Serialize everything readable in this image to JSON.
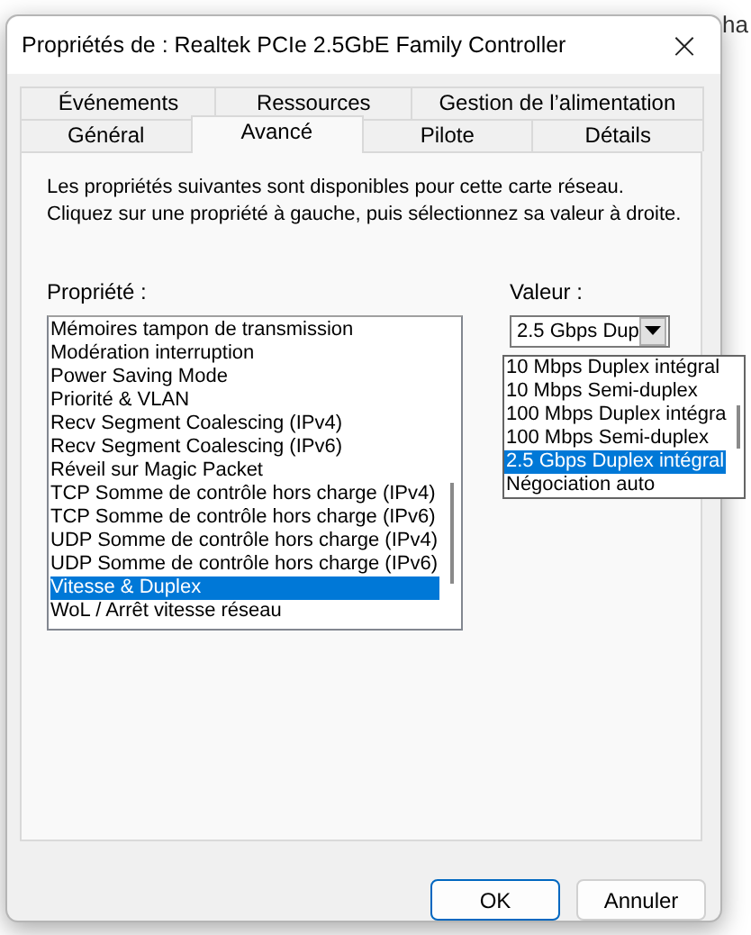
{
  "background_text": "ha",
  "window": {
    "title": "Propriétés de : Realtek PCIe 2.5GbE Family Controller",
    "close": "×"
  },
  "tab_rows": [
    {
      "tabs": [
        {
          "label": "Événements",
          "selected": false
        },
        {
          "label": "Ressources",
          "selected": false
        },
        {
          "label": "Gestion de l’alimentation",
          "selected": false
        }
      ]
    },
    {
      "tabs": [
        {
          "label": "Général",
          "selected": false
        },
        {
          "label": "Avancé",
          "selected": true
        },
        {
          "label": "Pilote",
          "selected": false
        },
        {
          "label": "Détails",
          "selected": false
        }
      ]
    }
  ],
  "description": "Les propriétés suivantes sont disponibles pour cette carte réseau. Cliquez sur une propriété à gauche, puis sélectionnez sa valeur à droite.",
  "property": {
    "label": "Propriété :",
    "items": [
      {
        "text": "Mémoires tampon de transmission",
        "selected": false
      },
      {
        "text": "Modération interruption",
        "selected": false
      },
      {
        "text": "Power Saving Mode",
        "selected": false
      },
      {
        "text": "Priorité & VLAN",
        "selected": false
      },
      {
        "text": "Recv Segment Coalescing (IPv4)",
        "selected": false
      },
      {
        "text": "Recv Segment Coalescing (IPv6)",
        "selected": false
      },
      {
        "text": "Réveil sur Magic Packet",
        "selected": false
      },
      {
        "text": "TCP Somme de contrôle hors charge (IPv4)",
        "selected": false
      },
      {
        "text": "TCP Somme de contrôle hors charge (IPv6)",
        "selected": false
      },
      {
        "text": "UDP Somme de contrôle hors charge (IPv4)",
        "selected": false
      },
      {
        "text": "UDP Somme de contrôle hors charge (IPv6)",
        "selected": false
      },
      {
        "text": "Vitesse & Duplex",
        "selected": true
      },
      {
        "text": "WoL / Arrêt vitesse réseau",
        "selected": false
      }
    ]
  },
  "value": {
    "label": "Valeur :",
    "combo_value": "2.5 Gbps Dup",
    "options": [
      {
        "text": "10 Mbps Duplex intégral",
        "selected": false
      },
      {
        "text": "10 Mbps Semi-duplex",
        "selected": false
      },
      {
        "text": "100 Mbps Duplex intégra",
        "selected": false
      },
      {
        "text": "100 Mbps Semi-duplex",
        "selected": false
      },
      {
        "text": "2.5 Gbps Duplex intégral",
        "selected": true
      },
      {
        "text": "Négociation auto",
        "selected": false
      }
    ]
  },
  "buttons": [
    {
      "label": "OK",
      "kind": "default"
    },
    {
      "label": "Annuler",
      "kind": "normal"
    }
  ]
}
